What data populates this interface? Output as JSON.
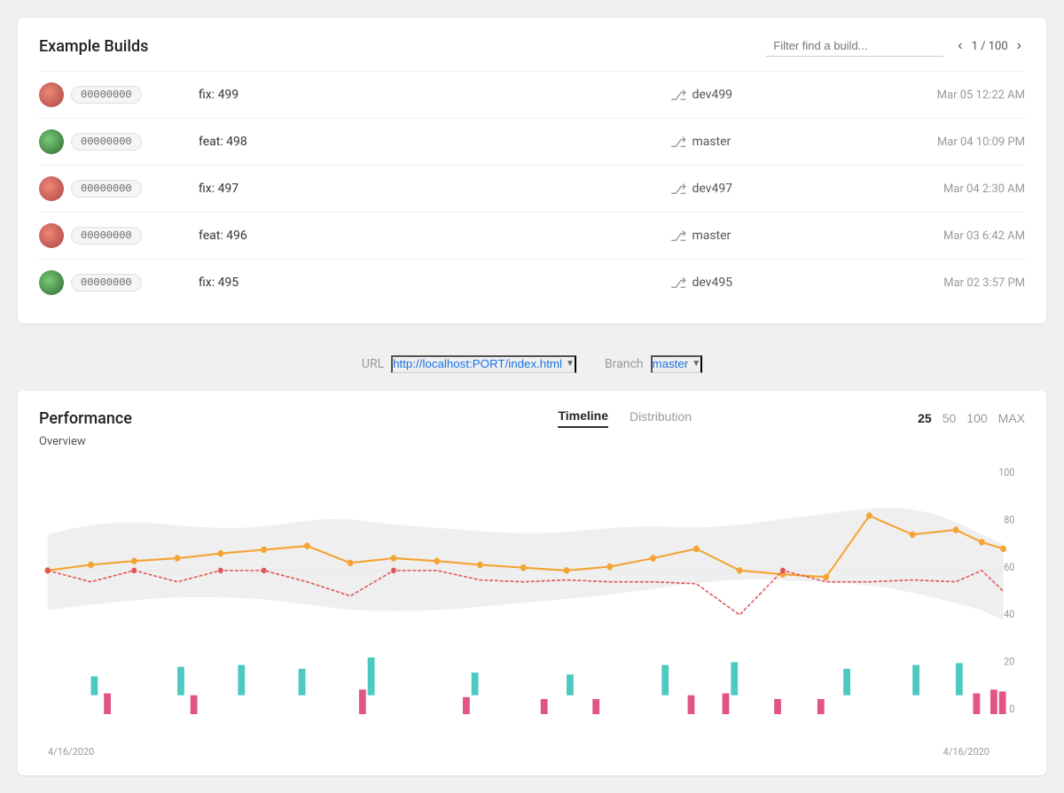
{
  "page": {
    "title": "Example Builds"
  },
  "builds": {
    "title": "Example Builds",
    "filter_placeholder": "Filter find a build...",
    "pagination": {
      "current": 1,
      "total": 100,
      "label": "1 / 100"
    },
    "rows": [
      {
        "id": "00000000",
        "avatar_class": "avatar-1",
        "description": "fix: 499",
        "branch": "dev499",
        "date": "Mar 05 12:22 AM"
      },
      {
        "id": "00000000",
        "avatar_class": "avatar-2",
        "description": "feat: 498",
        "branch": "master",
        "date": "Mar 04 10:09 PM"
      },
      {
        "id": "00000000",
        "avatar_class": "avatar-3",
        "description": "fix: 497",
        "branch": "dev497",
        "date": "Mar 04 2:30 AM"
      },
      {
        "id": "00000000",
        "avatar_class": "avatar-4",
        "description": "feat: 496",
        "branch": "master",
        "date": "Mar 03 6:42 AM"
      },
      {
        "id": "00000000",
        "avatar_class": "avatar-5",
        "description": "fix: 495",
        "branch": "dev495",
        "date": "Mar 02 3:57 PM"
      }
    ]
  },
  "filter_bar": {
    "url_label": "URL",
    "url_value": "http://localhost:PORT/index.html",
    "branch_label": "Branch",
    "branch_value": "master"
  },
  "performance": {
    "title": "Performance",
    "tabs": [
      "Timeline",
      "Distribution"
    ],
    "active_tab": "Timeline",
    "count_options": [
      "25",
      "50",
      "100",
      "MAX"
    ],
    "active_count": "25",
    "overview_label": "Overview",
    "y_axis": [
      100,
      80,
      60,
      40,
      20,
      0
    ],
    "date_start": "4/16/2020",
    "date_end": "4/16/2020"
  }
}
